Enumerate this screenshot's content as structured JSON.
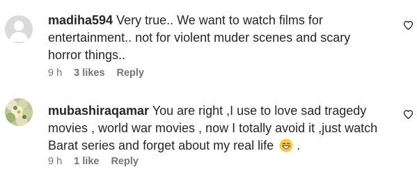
{
  "comments": [
    {
      "username": "madiha594",
      "text": "Very true.. We want to watch films for entertainment.. not for violent muder scenes and scary horror things..",
      "time": "9 h",
      "likes": "3 likes",
      "reply": "Reply",
      "avatar_icon": "default-avatar-icon"
    },
    {
      "username": "mubashiraqamar",
      "text": "You are right ,I use to love sad tragedy movies , world war movies , now I totally avoid it ,just watch Barat series and forget about my real life",
      "text_tail": ".",
      "emoji": "grinning-face-emoji",
      "time": "9 h",
      "likes": "1 like",
      "reply": "Reply",
      "avatar_icon": "flowers-avatar"
    }
  ],
  "like_icon": "heart-outline-icon"
}
